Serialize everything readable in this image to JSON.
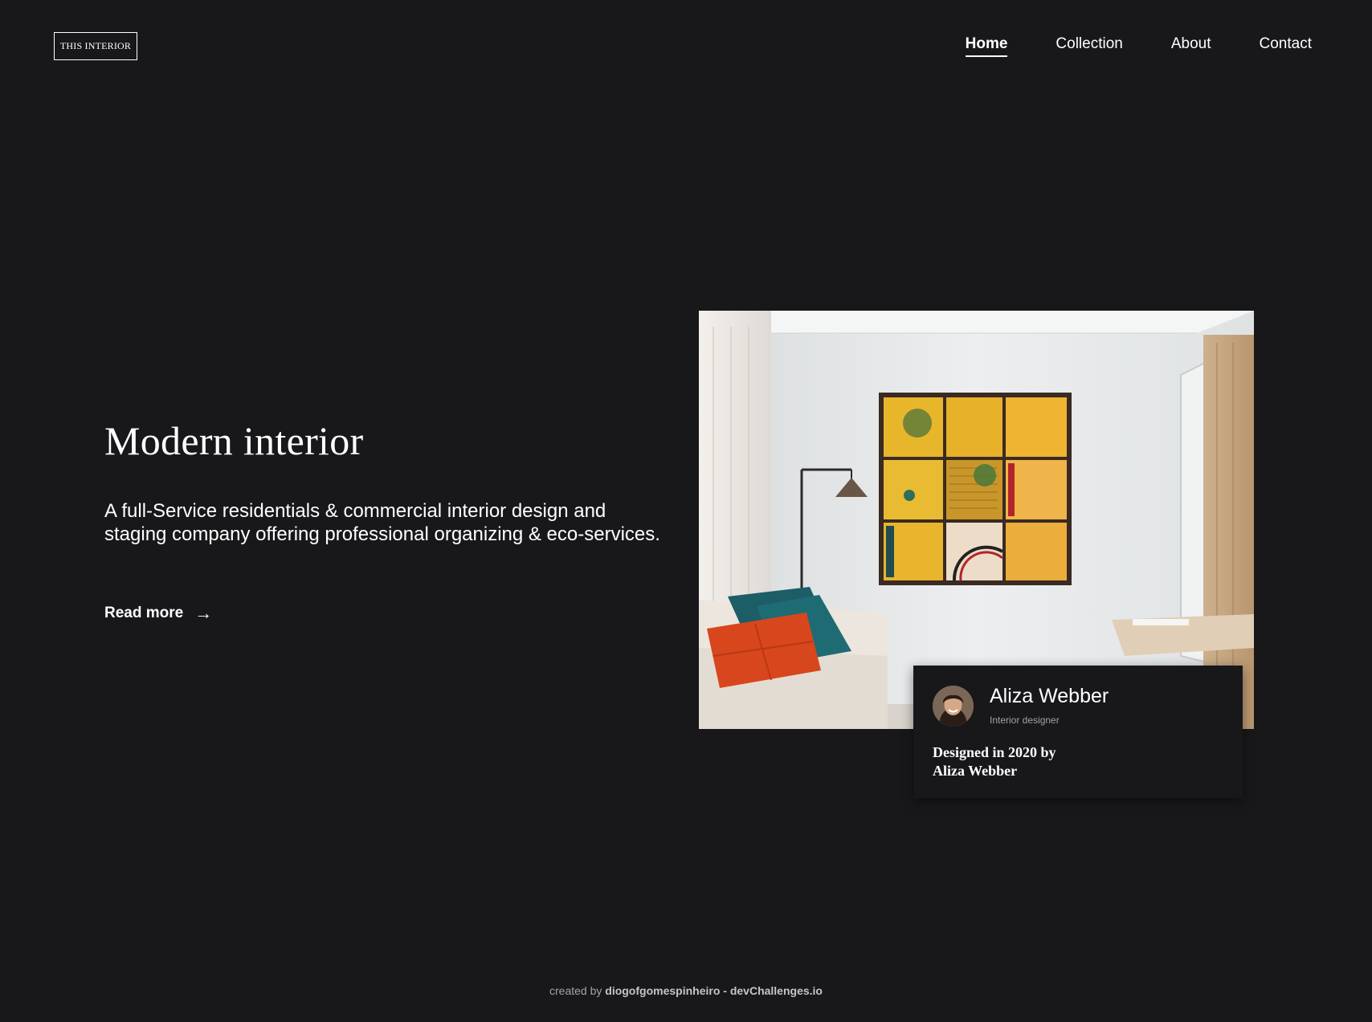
{
  "header": {
    "logo": "THIS INTERIOR",
    "nav": [
      {
        "label": "Home",
        "active": true
      },
      {
        "label": "Collection",
        "active": false
      },
      {
        "label": "About",
        "active": false
      },
      {
        "label": "Contact",
        "active": false
      }
    ]
  },
  "hero": {
    "title": "Modern interior",
    "description": "A full-Service residentials & commercial interior design and staging company offering professional organizing & eco-services.",
    "read_more_label": "Read more",
    "arrow_icon": "→",
    "image_alt": "Modern interior room with yellow framed wall art, sofa with orange and teal pillows, and floor lamp"
  },
  "designer": {
    "name": "Aliza Webber",
    "role": "Interior designer",
    "designed_line1": "Designed in 2020 by",
    "designed_line2": "Aliza Webber"
  },
  "footer": {
    "prefix": "created by",
    "author": "diogofgomespinheiro",
    "separator": "-",
    "site": "devChallenges.io"
  },
  "colors": {
    "background": "#18181b",
    "text": "#ffffff",
    "muted": "#a1a1aa"
  }
}
